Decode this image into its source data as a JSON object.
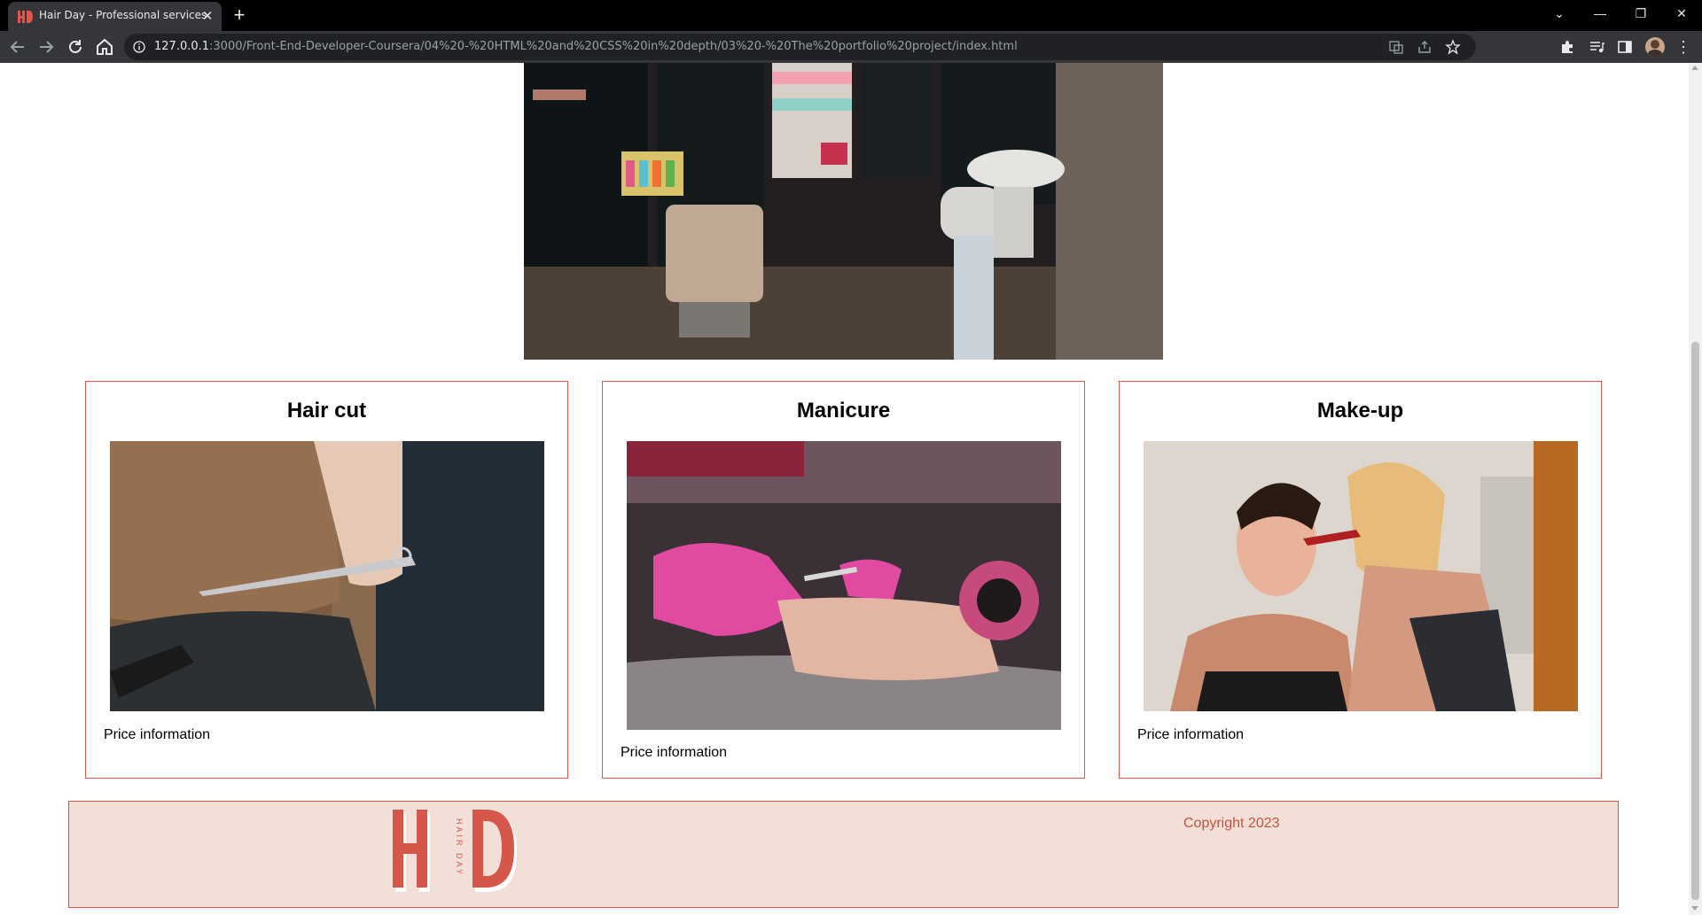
{
  "browser": {
    "tab_title": "Hair Day - Professional services",
    "url_host": "127.0.0.1",
    "url_rest": ":3000/Front-End-Developer-Coursera/04%20-%20HTML%20and%20CSS%20in%20depth/03%20-%20The%20portfolio%20project/index.html"
  },
  "services": [
    {
      "title": "Hair cut",
      "price": "Price information"
    },
    {
      "title": "Manicure",
      "price": "Price information"
    },
    {
      "title": "Make-up",
      "price": "Price information"
    }
  ],
  "footer": {
    "copyright": "Copyright 2023",
    "logo_text": "HAIR DAY"
  },
  "colors": {
    "accent": "#e0574a",
    "footer_bg": "#f2dfd7",
    "logo": "#d4574a"
  }
}
